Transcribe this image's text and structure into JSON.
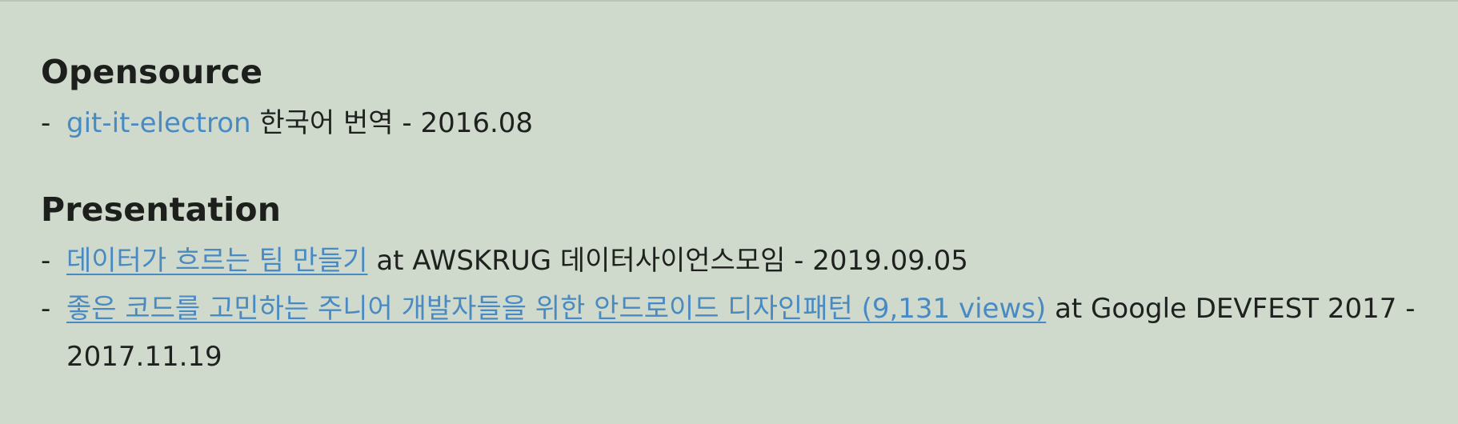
{
  "sections": [
    {
      "title": "Opensource",
      "items": [
        {
          "dash": "-",
          "link": "git-it-electron",
          "rest": " 한국어 번역 - 2016.08"
        }
      ]
    },
    {
      "title": "Presentation",
      "items": [
        {
          "dash": "-",
          "link": "데이터가 흐르는 팀 만들기",
          "rest": " at AWSKRUG 데이터사이언스모임 - 2019.09.05"
        },
        {
          "dash": "-",
          "link": "좋은 코드를 고민하는 주니어 개발자들을 위한 안드로이드 디자인패턴 (9,131 views)",
          "rest": " at Google DEVFEST 2017 - 2017.11.19"
        }
      ]
    }
  ],
  "colors": {
    "background": "#cfdacc",
    "text": "#1f211f",
    "link": "#4a8ac2"
  }
}
